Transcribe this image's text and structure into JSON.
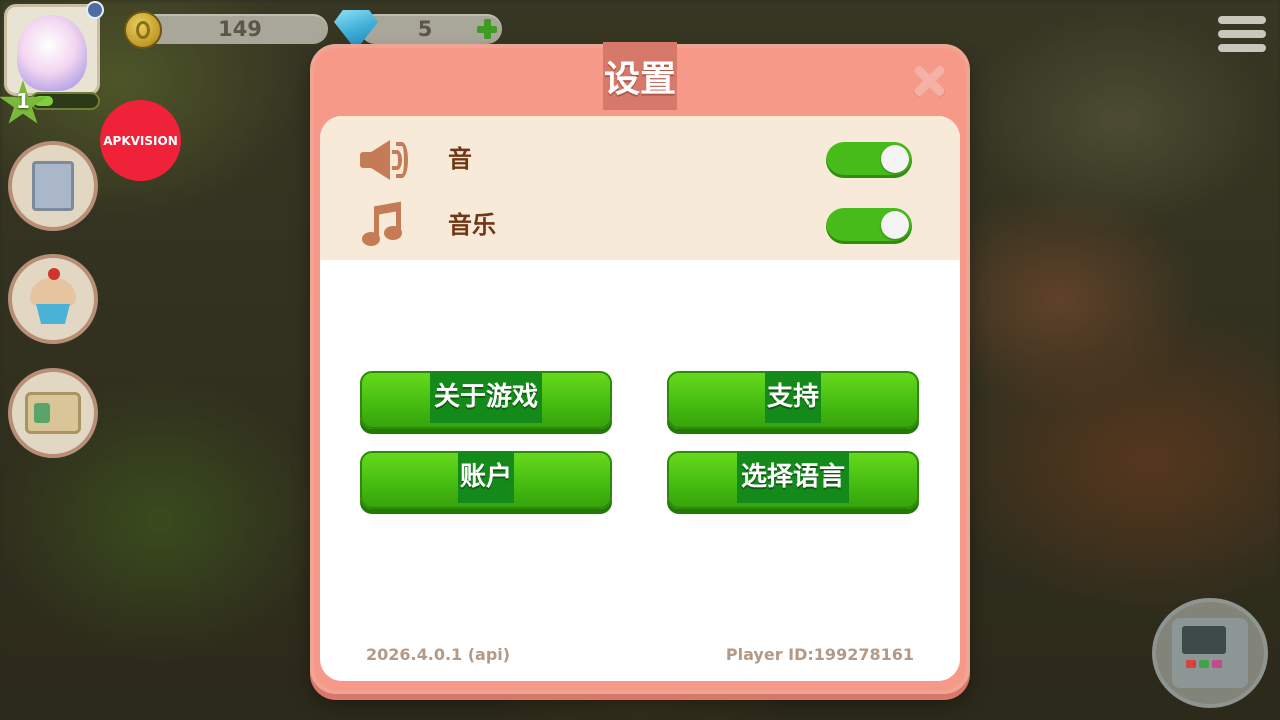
{
  "hud": {
    "level": "1",
    "xp_fraction": 0.3,
    "coins": "149",
    "gems": "5",
    "badge": "APKVISION"
  },
  "dialog": {
    "title": "设置",
    "settings": [
      {
        "icon": "speaker-icon",
        "label": "音",
        "enabled": true
      },
      {
        "icon": "music-note-icon",
        "label": "音乐",
        "enabled": true
      }
    ],
    "buttons": {
      "about": "关于游戏",
      "support": "支持",
      "account": "账户",
      "language": "选择语言"
    },
    "version": "2026.4.0.1 (api)",
    "player_id": "Player ID:199278161"
  },
  "colors": {
    "dialog_bg": "#f79988",
    "band_bg": "#f7ead9",
    "button_green": "#47bd12",
    "toggle_on": "#47bb1a",
    "label_brown": "#6f3715",
    "footer_text": "#b39a86",
    "badge_red": "#f0223a"
  }
}
